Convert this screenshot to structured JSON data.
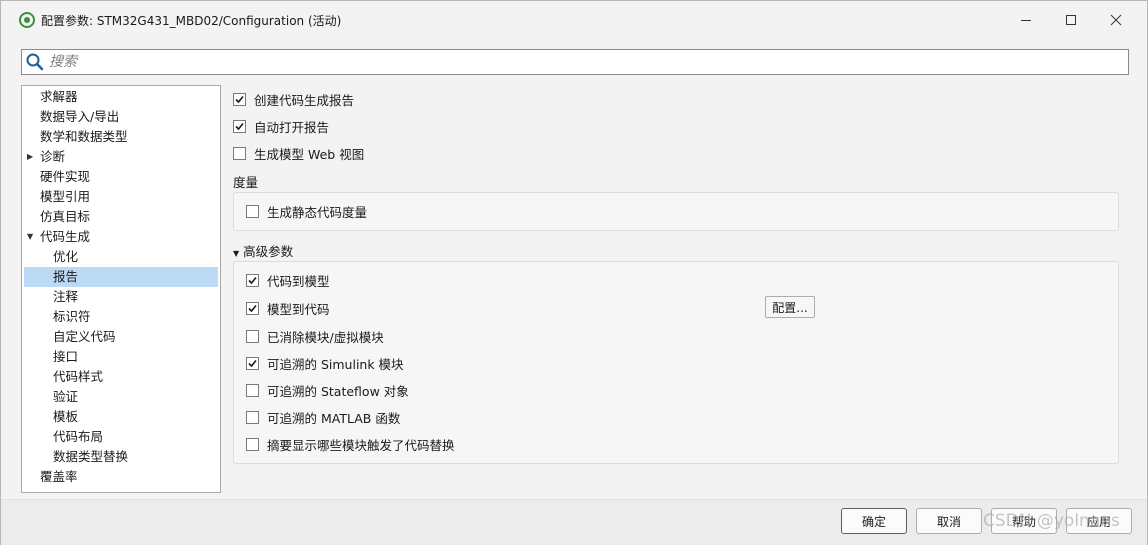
{
  "window": {
    "title": "配置参数: STM32G431_MBD02/Configuration (活动)"
  },
  "search": {
    "placeholder": "搜索"
  },
  "tree": {
    "items": [
      {
        "label": "求解器"
      },
      {
        "label": "数据导入/导出"
      },
      {
        "label": "数学和数据类型"
      },
      {
        "label": "诊断"
      },
      {
        "label": "硬件实现"
      },
      {
        "label": "模型引用"
      },
      {
        "label": "仿真目标"
      },
      {
        "label": "代码生成"
      },
      {
        "label": "优化"
      },
      {
        "label": "报告"
      },
      {
        "label": "注释"
      },
      {
        "label": "标识符"
      },
      {
        "label": "自定义代码"
      },
      {
        "label": "接口"
      },
      {
        "label": "代码样式"
      },
      {
        "label": "验证"
      },
      {
        "label": "模板"
      },
      {
        "label": "代码布局"
      },
      {
        "label": "数据类型替换"
      },
      {
        "label": "覆盖率"
      }
    ],
    "selected": "报告"
  },
  "report": {
    "create_report": {
      "label": "创建代码生成报告",
      "checked": true
    },
    "auto_open": {
      "label": "自动打开报告",
      "checked": true
    },
    "web_view": {
      "label": "生成模型 Web 视图",
      "checked": false
    }
  },
  "metrics": {
    "heading": "度量",
    "static_metrics": {
      "label": "生成静态代码度量",
      "checked": false
    }
  },
  "advanced": {
    "heading": "高级参数",
    "code_to_model": {
      "label": "代码到模型",
      "checked": true
    },
    "model_to_code": {
      "label": "模型到代码",
      "checked": true
    },
    "configure_label": "配置...",
    "eliminated_blocks": {
      "label": "已消除模块/虚拟模块",
      "checked": false
    },
    "simulink_blocks": {
      "label": "可追溯的 Simulink 模块",
      "checked": true
    },
    "stateflow_objects": {
      "label": "可追溯的 Stateflow 对象",
      "checked": false
    },
    "matlab_functions": {
      "label": "可追溯的 MATLAB 函数",
      "checked": false
    },
    "replacement_summary": {
      "label": "摘要显示哪些模块触发了代码替换",
      "checked": false
    }
  },
  "footer": {
    "ok_label": "确定",
    "cancel_label": "取消",
    "help_label": "帮助",
    "apply_label": "应用"
  },
  "watermark": "CSDN @yolnans",
  "icons": {
    "app": "simulink-logo-icon",
    "search": "search-icon",
    "minimize": "minimize-icon",
    "maximize": "maximize-icon",
    "close": "close-icon"
  },
  "colors": {
    "selection": "#bcdaf3",
    "app_icon": "#3d8f3d"
  }
}
